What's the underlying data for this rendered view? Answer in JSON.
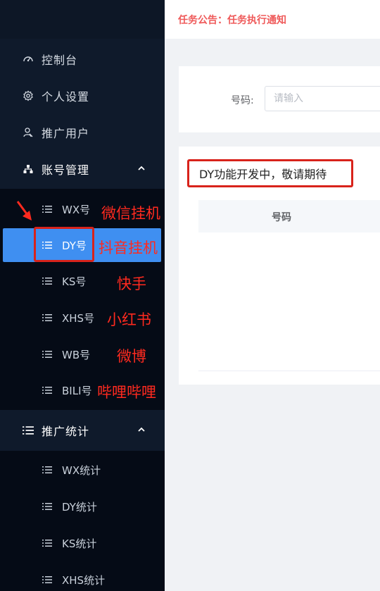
{
  "topbar": {
    "notice": "任务公告：任务执行通知"
  },
  "sidebar": {
    "items": [
      {
        "label": "控制台",
        "icon": "dashboard-icon"
      },
      {
        "label": "个人设置",
        "icon": "gear-icon"
      },
      {
        "label": "推广用户",
        "icon": "user-icon"
      }
    ],
    "account_group": {
      "label": "账号管理",
      "icon": "org-chart-icon",
      "expanded": true,
      "children": [
        {
          "label": "WX号",
          "icon": "list-icon"
        },
        {
          "label": "DY号",
          "icon": "list-icon",
          "active": true
        },
        {
          "label": "KS号",
          "icon": "list-icon"
        },
        {
          "label": "XHS号",
          "icon": "list-icon"
        },
        {
          "label": "WB号",
          "icon": "list-icon"
        },
        {
          "label": "BILI号",
          "icon": "list-icon"
        }
      ]
    },
    "stats_group": {
      "label": "推广统计",
      "icon": "list-icon",
      "expanded": true,
      "children": [
        {
          "label": "WX统计",
          "icon": "list-icon"
        },
        {
          "label": "DY统计",
          "icon": "list-icon"
        },
        {
          "label": "KS统计",
          "icon": "list-icon"
        },
        {
          "label": "XHS统计",
          "icon": "list-icon"
        }
      ]
    }
  },
  "annotations": [
    "微信挂机",
    "抖音挂机",
    "快手",
    "小红书",
    "微博",
    "哔哩哔哩"
  ],
  "search": {
    "label": "号码:",
    "placeholder": "请输入"
  },
  "table": {
    "dev_message": "DY功能开发中，敬请期待",
    "columns": [
      "号码"
    ]
  },
  "colors": {
    "sidebar_bg": "#0f1a2b",
    "active_item": "#3f8ff1",
    "notice_text": "#ef5a5a",
    "annotation_red": "#ff2a1f"
  }
}
